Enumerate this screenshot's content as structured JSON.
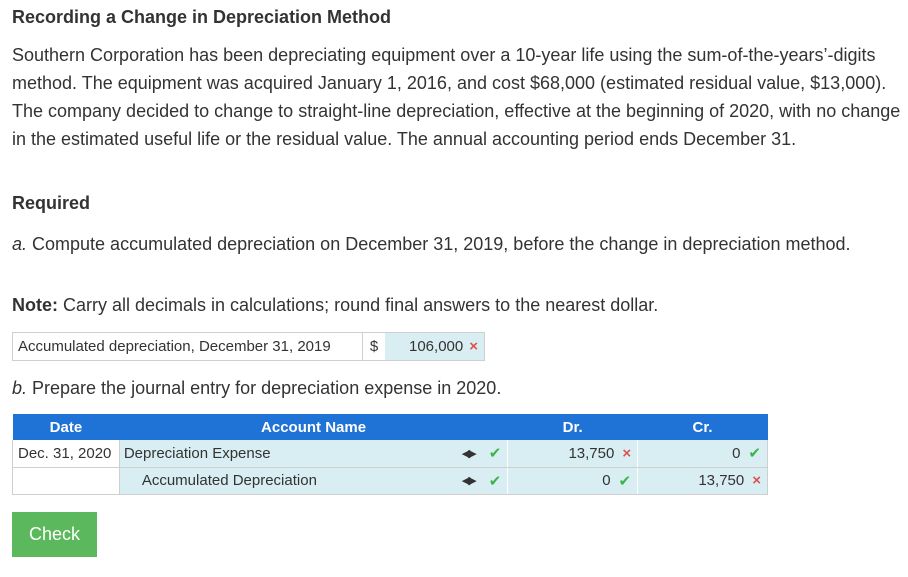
{
  "title": "Recording a Change in Depreciation Method",
  "problem_text": "Southern Corporation has been depreciating equipment over a 10-year life using the sum-of-the-years’-digits method. The equipment was acquired January 1, 2016, and cost $68,000 (estimated residual value, $13,000). The company decided to change to straight-line depreciation, effective at the beginning of 2020, with no change in the estimated useful life or the residual value. The annual accounting period ends December 31.",
  "required_heading": "Required",
  "part_a": {
    "letter": "a.",
    "text": " Compute accumulated depreciation on December 31, 2019, before the change in depreciation method."
  },
  "note": {
    "label": "Note:",
    "text": " Carry all decimals in calculations; round final answers to the nearest dollar."
  },
  "accumulated": {
    "label": "Accumulated depreciation, December 31, 2019",
    "currency": "$",
    "value": "106,000",
    "status_icon": "×"
  },
  "part_b": {
    "letter": "b.",
    "text": " Prepare the journal entry for depreciation expense in 2020."
  },
  "journal": {
    "headers": {
      "date": "Date",
      "account": "Account Name",
      "dr": "Dr.",
      "cr": "Cr."
    },
    "rows": [
      {
        "date": "Dec. 31, 2020",
        "account": "Depreciation Expense",
        "account_status": "✔",
        "dr": "13,750",
        "dr_status": "×",
        "cr": "0",
        "cr_status": "✔"
      },
      {
        "date": "",
        "account": "Accumulated Depreciation",
        "account_status": "✔",
        "dr": "0",
        "dr_status": "✔",
        "cr": "13,750",
        "cr_status": "×"
      }
    ],
    "selector_glyph": "◀▶"
  },
  "check_button": "Check",
  "colors": {
    "header_blue": "#1f72d6",
    "input_bg": "#d9eef3",
    "correct": "#3ab54a",
    "incorrect": "#d9534f",
    "check_green": "#5cb85c"
  }
}
